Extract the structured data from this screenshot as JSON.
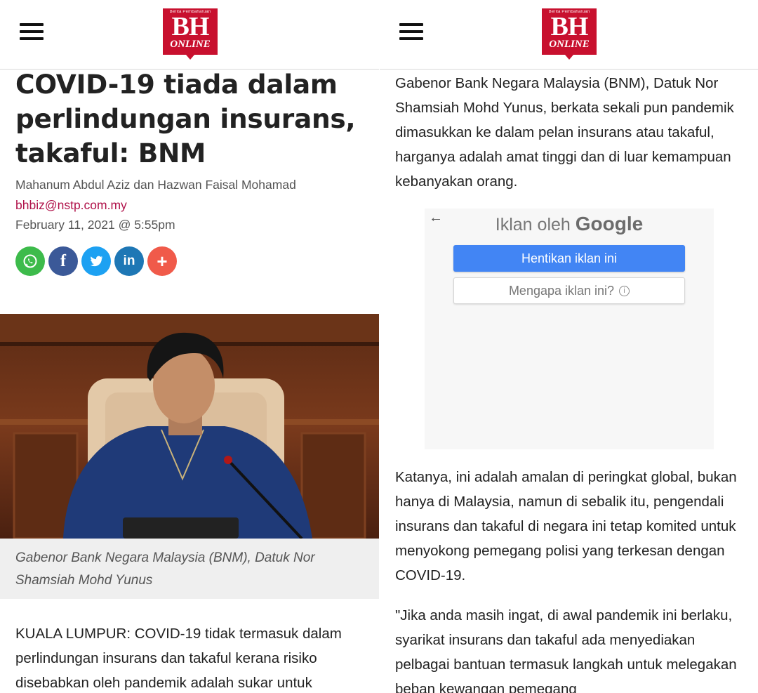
{
  "left_screen": {
    "header": {
      "menu_icon": "hamburger-icon",
      "logo": {
        "tagline": "Berita Pembaharuan",
        "main": "BH",
        "sub": "ONLINE"
      }
    },
    "article": {
      "headline": "COVID-19 tiada dalam perlindungan insurans, takaful: BNM",
      "authors": "Mahanum Abdul Aziz dan Hazwan Faisal Mohamad",
      "email": "bhbiz@nstp.com.my",
      "date": "February 11, 2021 @ 5:55pm",
      "share_buttons": [
        {
          "icon": "whatsapp-icon",
          "color": "#3dbb4b"
        },
        {
          "icon": "facebook-icon",
          "glyph": "f",
          "color": "#3b5998"
        },
        {
          "icon": "twitter-icon",
          "color": "#1da1f2"
        },
        {
          "icon": "linkedin-icon",
          "glyph": "in",
          "color": "#1e77b5"
        },
        {
          "icon": "more-icon",
          "glyph": "+",
          "color": "#f05a4a"
        }
      ],
      "photo_caption": "Gabenor Bank Negara Malaysia (BNM), Datuk Nor Shamsiah Mohd Yunus",
      "lead_paragraph": "KUALA LUMPUR: COVID-19 tidak termasuk dalam perlindungan insurans dan takaful kerana risiko disebabkan oleh pandemik adalah sukar untuk"
    }
  },
  "right_screen": {
    "header": {
      "menu_icon": "hamburger-icon",
      "logo": {
        "tagline": "Berita Pembaharuan",
        "main": "BH",
        "sub": "ONLINE"
      }
    },
    "paragraphs": [
      "Gabenor Bank Negara Malaysia (BNM), Datuk Nor Shamsiah Mohd Yunus, berkata sekali pun pandemik dimasukkan ke dalam pelan insurans atau takaful, harganya adalah amat tinggi dan di luar kemampuan kebanyakan orang.",
      "Katanya, ini adalah amalan di peringkat global, bukan hanya di Malaysia, namun di sebalik itu, pengendali insurans dan takaful di negara ini tetap komited untuk menyokong pemegang polisi yang terkesan dengan COVID-19.",
      "\"Jika anda masih ingat, di awal pandemik ini berlaku, syarikat insurans dan takaful ada menyediakan pelbagai bantuan termasuk langkah untuk melegakan beban kewangan pemegang"
    ],
    "ad": {
      "back_icon": "arrow-left-icon",
      "title_prefix": "Iklan oleh",
      "title_brand": "Google",
      "stop_button": "Hentikan iklan ini",
      "why_button": "Mengapa iklan ini?",
      "info_icon": "info-icon"
    }
  },
  "colors": {
    "brand_red": "#c8102e",
    "link": "#b0124a",
    "ad_button_blue": "#4285f4"
  }
}
